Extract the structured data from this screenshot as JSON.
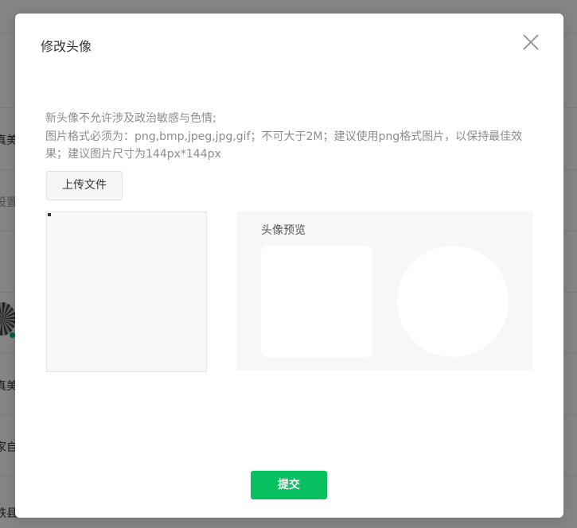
{
  "background": {
    "rows": [
      {
        "text": "真美"
      },
      {
        "text": "设置"
      },
      {
        "text": "真美"
      },
      {
        "text": "家自"
      },
      {
        "text": "铁县"
      }
    ]
  },
  "modal": {
    "title": "修改头像",
    "notice_line1": "新头像不允许涉及政治敏感与色情;",
    "notice_line2": "图片格式必须为：png,bmp,jpeg,jpg,gif；不可大于2M；建议使用png格式图片，以保持最佳效果；建议图片尺寸为144px*144px",
    "upload_label": "上传文件",
    "preview_title": "头像预览",
    "submit_label": "提交"
  },
  "icons": {
    "close": "close-icon"
  },
  "colors": {
    "accent": "#07c160",
    "panel_bg": "#f6f7f9",
    "text_muted": "#8d8d8d"
  }
}
